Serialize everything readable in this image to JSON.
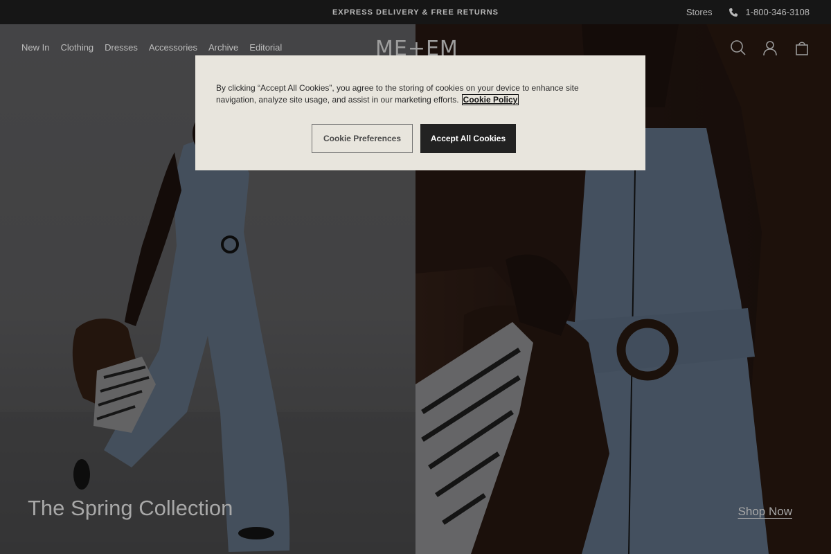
{
  "topbar": {
    "promo": "EXPRESS DELIVERY & FREE RETURNS",
    "stores": "Stores",
    "phone": "1-800-346-3108"
  },
  "header": {
    "logo": "ME+EM",
    "nav": [
      "New In",
      "Clothing",
      "Dresses",
      "Accessories",
      "Archive",
      "Editorial"
    ],
    "icons": [
      "search-icon",
      "account-icon",
      "bag-icon"
    ]
  },
  "hero": {
    "title": "The Spring Collection",
    "cta": "Shop Now"
  },
  "cookie_banner": {
    "text": "By clicking “Accept All Cookies”, you agree to the storing of cookies on your device to enhance site navigation, analyze site usage, and assist in our marketing efforts.",
    "policy_link": "Cookie Policy",
    "preferences_button": "Cookie Preferences",
    "accept_button": "Accept All Cookies"
  },
  "colors": {
    "banner_bg": "#e8e5dd",
    "accept_bg": "#222222",
    "topbar_bg": "#161616"
  }
}
